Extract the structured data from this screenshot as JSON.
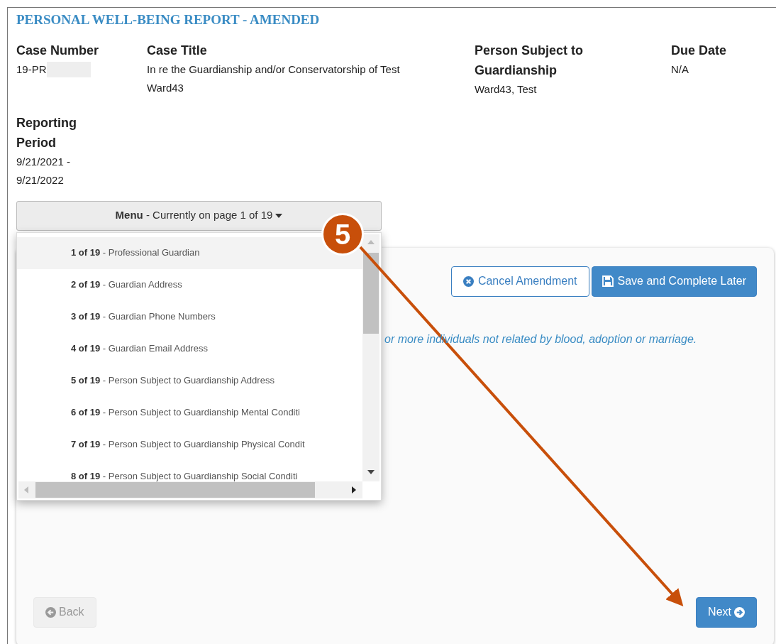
{
  "title": "PERSONAL WELL-BEING REPORT - AMENDED",
  "fields": [
    {
      "label": "Case Number",
      "value": "19-PR",
      "redacted": true
    },
    {
      "label": "Case Title",
      "value": "In re the Guardianship and/or Conservatorship of Test Ward43",
      "redacted": false
    },
    {
      "label": "Person Subject to Guardianship",
      "value": "Ward43, Test",
      "redacted": false
    },
    {
      "label": "Due Date",
      "value": "N/A",
      "redacted": false
    },
    {
      "label": "Reporting Period",
      "value": "9/21/2021 - 9/21/2022",
      "redacted": false
    }
  ],
  "menu": {
    "label": "**Menu** - Currently on page 1 of 19"
  },
  "pages": [
    {
      "number": "1 of 19",
      "title": "- Professional Guardian",
      "selected": true
    },
    {
      "number": "2 of 19",
      "title": "- Guardian Address",
      "selected": false
    },
    {
      "number": "3 of 19",
      "title": "- Guardian Phone Numbers",
      "selected": false
    },
    {
      "number": "4 of 19",
      "title": "- Guardian Email Address",
      "selected": false
    },
    {
      "number": "5 of 19",
      "title": "- Person Subject to Guardianship Address",
      "selected": false
    },
    {
      "number": "6 of 19",
      "title": "- Person Subject to Guardianship Mental Conditi",
      "selected": false
    },
    {
      "number": "7 of 19",
      "title": "- Person Subject to Guardianship Physical Condit",
      "selected": false
    },
    {
      "number": "8 of 19",
      "title": "- Person Subject to Guardianship Social Conditi",
      "selected": false
    }
  ],
  "actions": [
    {
      "label": "Cancel Amendment",
      "kind": "outline"
    },
    {
      "label": "Save and Complete Later",
      "kind": "primary"
    }
  ],
  "note": "or more individuals not related by blood, adoption or marriage.",
  "nav": [
    {
      "label": "Back",
      "disabled": true,
      "kind": "back"
    },
    {
      "label": "Next",
      "disabled": false,
      "kind": "next"
    }
  ],
  "callout": {
    "number": "5"
  }
}
